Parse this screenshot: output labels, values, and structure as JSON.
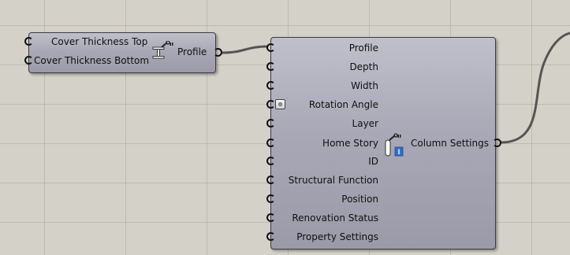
{
  "canvas": {
    "background": "#d4d1c8"
  },
  "cover_component": {
    "inputs": [
      {
        "label": "Cover Thickness Top"
      },
      {
        "label": "Cover Thickness Bottom"
      }
    ],
    "icon": "profile-beam-icon",
    "output": {
      "label": "Profile"
    }
  },
  "column_component": {
    "inputs": [
      {
        "label": "Profile"
      },
      {
        "label": "Depth"
      },
      {
        "label": "Width"
      },
      {
        "label": "Rotation Angle"
      },
      {
        "label": "Layer"
      },
      {
        "label": "Home Story"
      },
      {
        "label": "ID"
      },
      {
        "label": "Structural Function"
      },
      {
        "label": "Position"
      },
      {
        "label": "Renovation Status"
      },
      {
        "label": "Property Settings"
      }
    ],
    "icon": "column-settings-icon",
    "output": {
      "label": "Column Settings"
    }
  },
  "colors": {
    "component_fill": "#a8a8b6",
    "component_border": "#3c3c42",
    "wire": "#555555",
    "icon_accent": "#2f6fd0"
  }
}
